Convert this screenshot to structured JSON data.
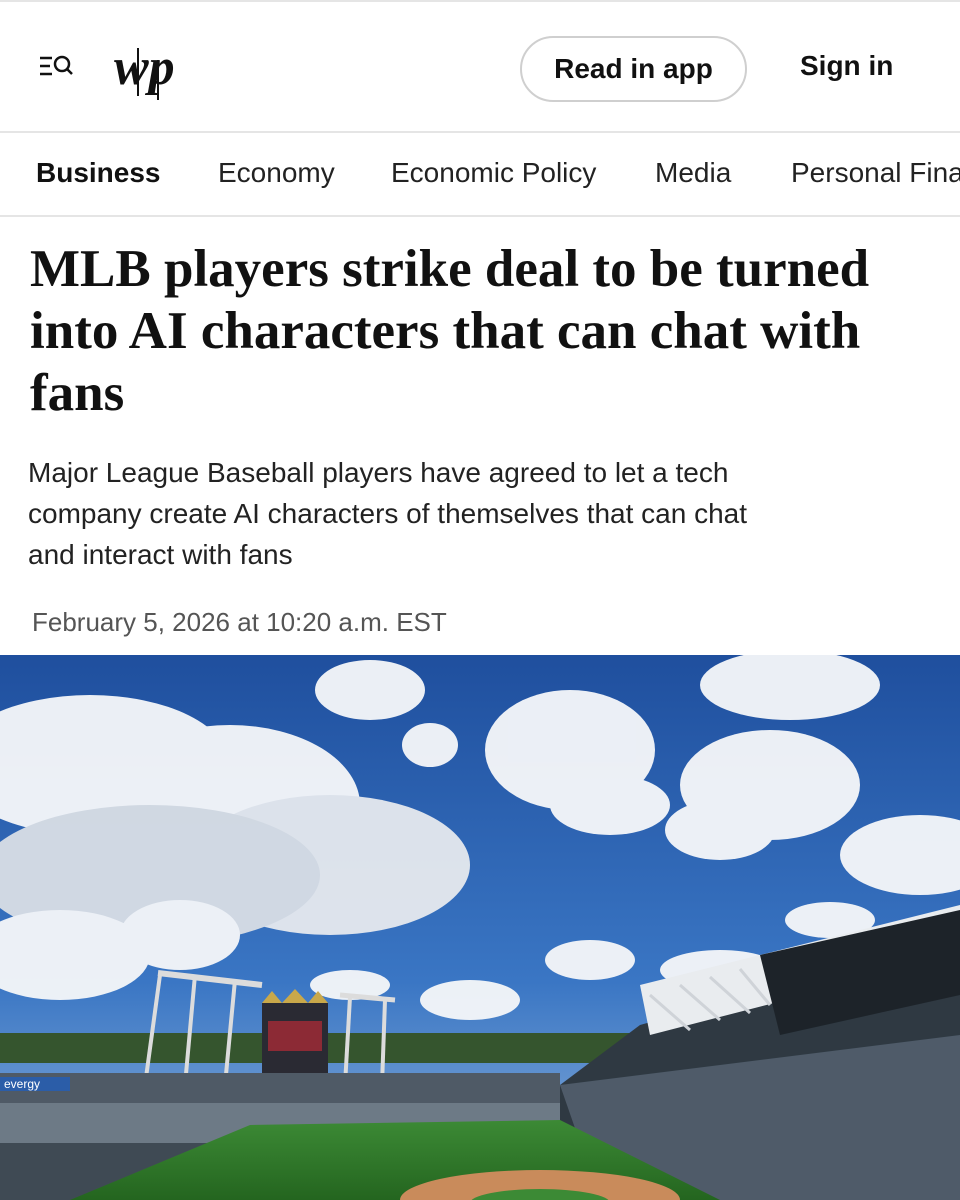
{
  "header": {
    "logo_text": "wp",
    "read_in_app": "Read in app",
    "sign_in": "Sign in"
  },
  "nav": {
    "items": [
      {
        "label": "Business",
        "active": true
      },
      {
        "label": "Economy",
        "active": false
      },
      {
        "label": "Economic Policy",
        "active": false
      },
      {
        "label": "Media",
        "active": false
      },
      {
        "label": "Personal Finance",
        "active": false
      }
    ]
  },
  "article": {
    "headline": "MLB players strike deal to be turned into AI characters that can chat with fans",
    "dek": "Major League Baseball players have agreed to let a tech company create AI characters of themselves that can chat and interact with fans",
    "dateline": "February 5, 2026 at 10:20 a.m. EST"
  },
  "hero": {
    "description_signage": "evergy",
    "colors": {
      "sky": "#2d63b4",
      "grass": "#2f7a2c",
      "clay": "#c98b5b"
    }
  },
  "icons": [
    "menu-search-icon",
    "wp-logo"
  ]
}
